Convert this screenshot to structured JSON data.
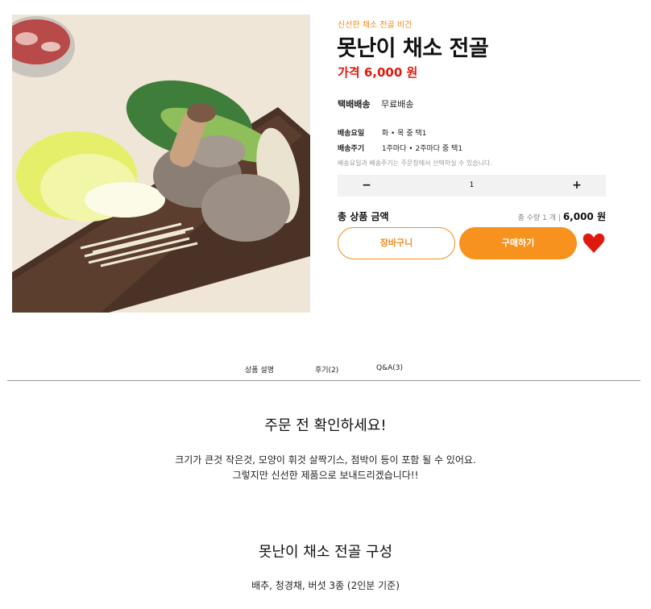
{
  "product": {
    "image_alt": "vegetables-mushrooms-photo",
    "tagline": "신선한 채소 전골 비건",
    "title": "못난이 채소 전골",
    "price": "가격 6,000 원"
  },
  "delivery": {
    "label": "택배배송",
    "value": "무료배송"
  },
  "schedule": {
    "day_label": "배송요일",
    "day_value": "화 • 목 중 택1",
    "cycle_label": "배송주기",
    "cycle_value": "1주마다 • 2주마다 중 택1",
    "note": "배송요일과 배송주기는 주문창에서 선택하실 수 있습니다."
  },
  "quantity": {
    "minus": "−",
    "value": "1",
    "plus": "+"
  },
  "total": {
    "label": "총 상품 금액",
    "count_text": "총 수량 1 개 |",
    "amount": "6,000 원"
  },
  "buttons": {
    "cart": "장바구니",
    "buy": "구매하기"
  },
  "colors": {
    "accent": "#f7921e",
    "price": "#e0190f",
    "heart": "#e0190f"
  },
  "tabs": [
    {
      "label": "상품 설명"
    },
    {
      "label": "후기(2)"
    },
    {
      "label": "Q&A(3)"
    }
  ],
  "notice": {
    "title": "주문 전 확인하세요!",
    "line1": "크기가 큰것 작은것, 모양이 휘것 살짝기스, 점박이 등이 포함 될 수 있어요.",
    "line2": "그렇지만  신선한 제품으로 보내드리겠습니다!!"
  },
  "composition": {
    "title": "못난이 채소 전골  구성",
    "body": "배추, 청경채, 버섯 3종 (2인분 기준)"
  }
}
